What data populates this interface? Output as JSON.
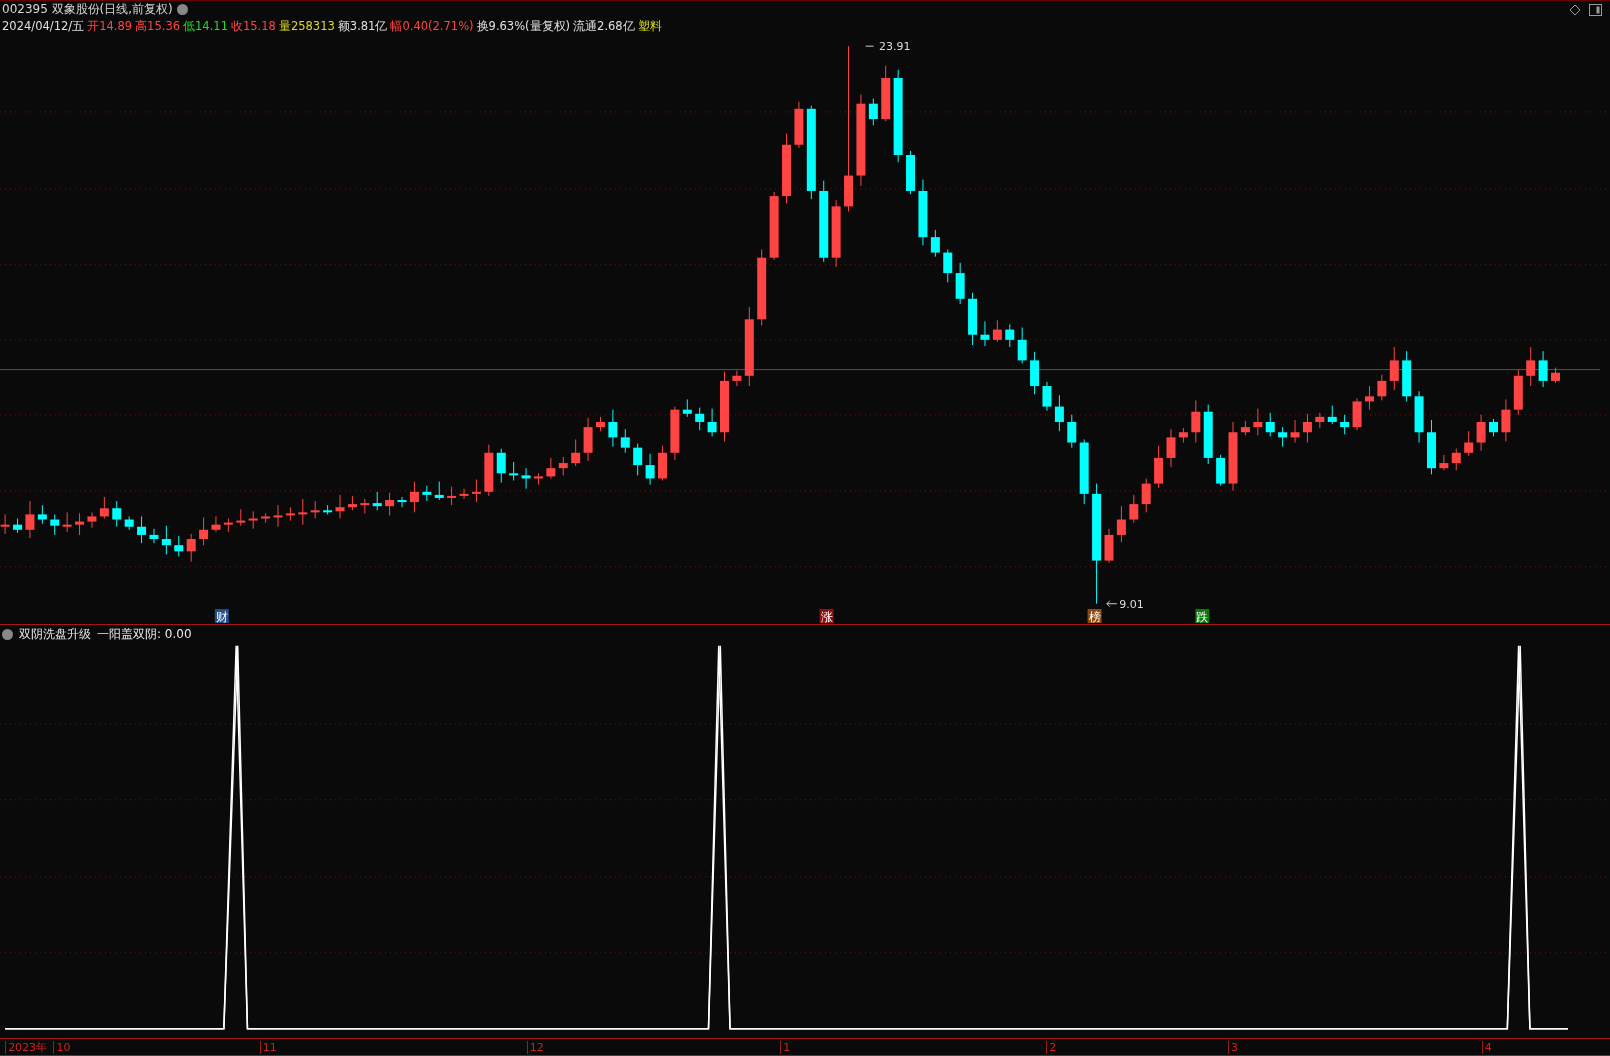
{
  "header": {
    "code": "002395",
    "name": "双象股份",
    "mode": "(日线,前复权)"
  },
  "quote": {
    "date": "2024/04/12/五",
    "fields": [
      {
        "label": "开",
        "value": "14.89",
        "color": "#ff4444"
      },
      {
        "label": "高",
        "value": "15.36",
        "color": "#ff4444"
      },
      {
        "label": "低",
        "value": "14.11",
        "color": "#22dd22"
      },
      {
        "label": "收",
        "value": "15.18",
        "color": "#ff4444"
      },
      {
        "label": "量",
        "value": "258313",
        "color": "#dddd22"
      },
      {
        "label": "额",
        "value": "3.81亿",
        "color": "#e0e0e0"
      },
      {
        "label": "幅",
        "value": "0.40(2.71%)",
        "color": "#ff4444"
      },
      {
        "label": "换",
        "value": "9.63%(量复权)",
        "color": "#e0e0e0"
      },
      {
        "label": "流通",
        "value": "2.68亿",
        "color": "#e0e0e0"
      }
    ],
    "industry": "塑料"
  },
  "main_chart": {
    "high_label": "23.91",
    "low_label": "9.01",
    "markers": [
      {
        "text": "财",
        "color": "#1f4e8c"
      },
      {
        "text": "涨",
        "color": "#8b1010"
      },
      {
        "text": "榜",
        "color": "#8a4a10"
      },
      {
        "text": "跌",
        "color": "#0a7a0a"
      }
    ]
  },
  "indicator": {
    "title": "双阴洗盘升级",
    "series_label": "一阳盖双阴: 0.00"
  },
  "time_axis": {
    "labels": [
      "2023年",
      "10",
      "11",
      "12",
      "1",
      "2",
      "3",
      "4"
    ]
  }
}
